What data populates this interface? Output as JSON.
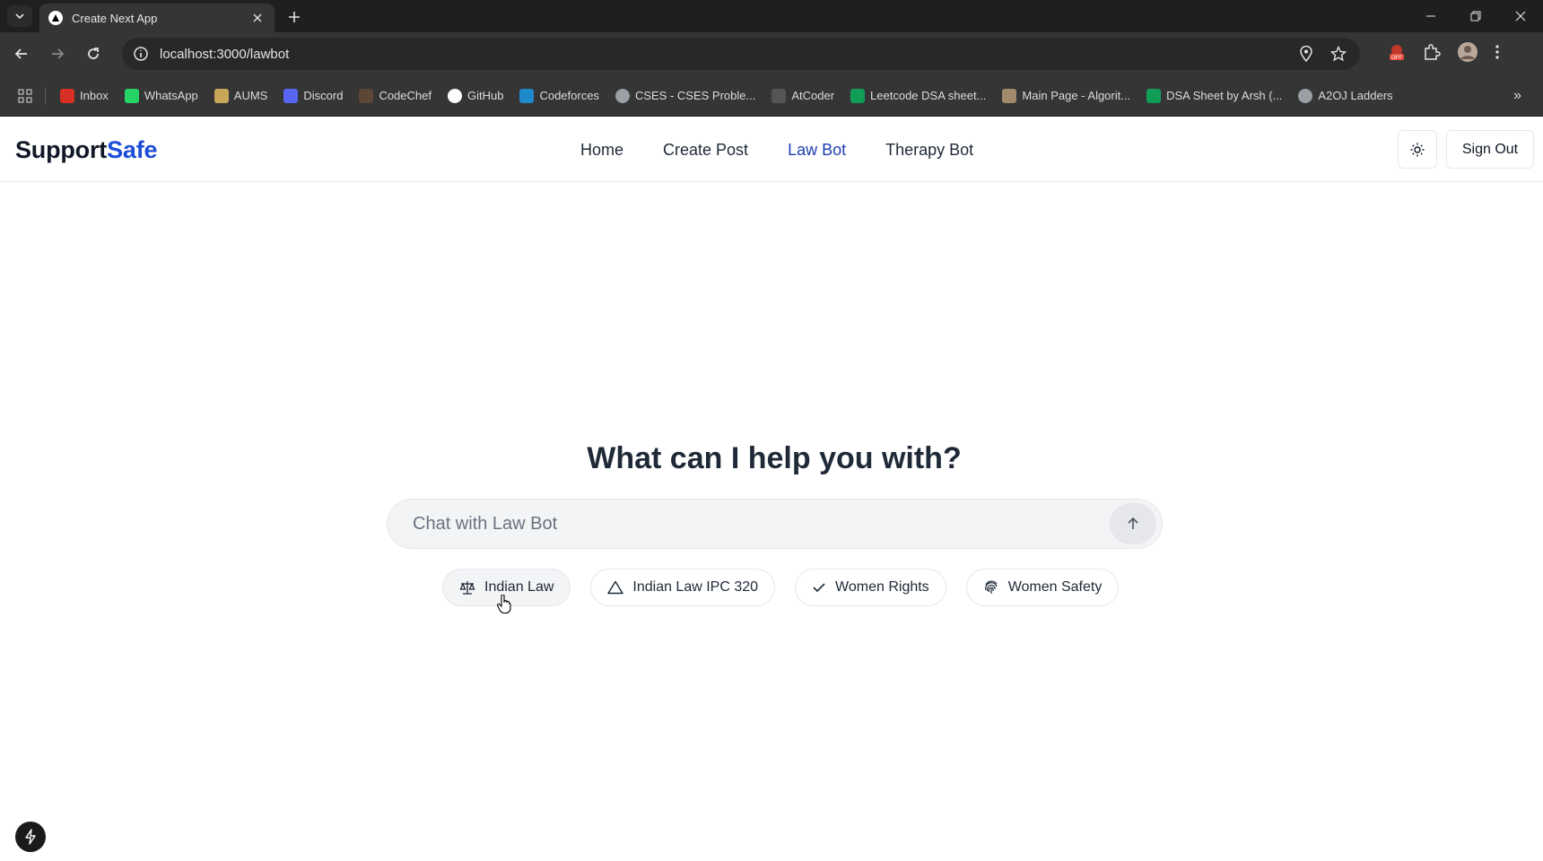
{
  "browser": {
    "tab_title": "Create Next App",
    "url": "localhost:3000/lawbot",
    "bookmarks": [
      {
        "label": "Inbox",
        "icon": "gmail-icon",
        "color": "#d93025"
      },
      {
        "label": "WhatsApp",
        "icon": "whatsapp-icon",
        "color": "#25d366"
      },
      {
        "label": "AUMS",
        "icon": "aums-icon",
        "color": "#c8a75a"
      },
      {
        "label": "Discord",
        "icon": "discord-icon",
        "color": "#5865f2"
      },
      {
        "label": "CodeChef",
        "icon": "codechef-icon",
        "color": "#5b4638"
      },
      {
        "label": "GitHub",
        "icon": "github-icon",
        "color": "#ffffff"
      },
      {
        "label": "Codeforces",
        "icon": "codeforces-icon",
        "color": "#1f8acb"
      },
      {
        "label": "CSES - CSES Proble...",
        "icon": "globe-icon",
        "color": "#9aa0a6"
      },
      {
        "label": "AtCoder",
        "icon": "atcoder-icon",
        "color": "#555555"
      },
      {
        "label": "Leetcode DSA sheet...",
        "icon": "sheets-icon",
        "color": "#0f9d58"
      },
      {
        "label": "Main Page - Algorit...",
        "icon": "algorithmica-icon",
        "color": "#a08a6a"
      },
      {
        "label": "DSA Sheet by Arsh (...",
        "icon": "sheets-icon",
        "color": "#0f9d58"
      },
      {
        "label": "A2OJ Ladders",
        "icon": "globe-icon",
        "color": "#9aa0a6"
      }
    ]
  },
  "site": {
    "brand_prefix": "Support",
    "brand_accent": "Safe",
    "accent_color": "#1d4ed8",
    "nav": [
      {
        "label": "Home",
        "active": false
      },
      {
        "label": "Create Post",
        "active": false
      },
      {
        "label": "Law Bot",
        "active": true
      },
      {
        "label": "Therapy Bot",
        "active": false
      }
    ],
    "theme_toggle_icon": "sun-icon",
    "sign_out_label": "Sign Out"
  },
  "main": {
    "heading": "What can I help you with?",
    "chat_placeholder": "Chat with Law Bot",
    "chat_value": "",
    "send_icon": "arrow-up-icon",
    "suggestions": [
      {
        "label": "Indian Law",
        "icon": "scale-icon"
      },
      {
        "label": "Indian Law IPC 320",
        "icon": "triangle-icon"
      },
      {
        "label": "Women Rights",
        "icon": "check-icon"
      },
      {
        "label": "Women Safety",
        "icon": "fingerprint-icon"
      }
    ]
  },
  "dev_tools_icon": "bolt-icon"
}
